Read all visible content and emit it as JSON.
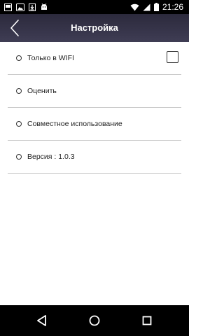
{
  "status_bar": {
    "time": "21:26",
    "left_icons": [
      "notification-box-icon",
      "photo-icon",
      "download-icon",
      "android-icon"
    ],
    "right_icons": [
      "wifi-icon",
      "signal-icon",
      "battery-icon"
    ]
  },
  "app_bar": {
    "title": "Настройка",
    "back_icon": "chevron-left-icon"
  },
  "settings": {
    "items": [
      {
        "label": "Только в WIFI",
        "has_checkbox": true,
        "checked": false
      },
      {
        "label": "Оценить",
        "has_checkbox": false
      },
      {
        "label": "Совместное использование",
        "has_checkbox": false
      },
      {
        "label": "Версия : 1.0.3",
        "has_checkbox": false
      }
    ]
  },
  "nav_bar": {
    "buttons": [
      "back-triangle-icon",
      "home-circle-icon",
      "recents-square-icon"
    ]
  },
  "colors": {
    "app_bar": "#353348",
    "status_bar": "#000000",
    "nav_bar": "#000000",
    "divider": "#c8c8c8"
  }
}
